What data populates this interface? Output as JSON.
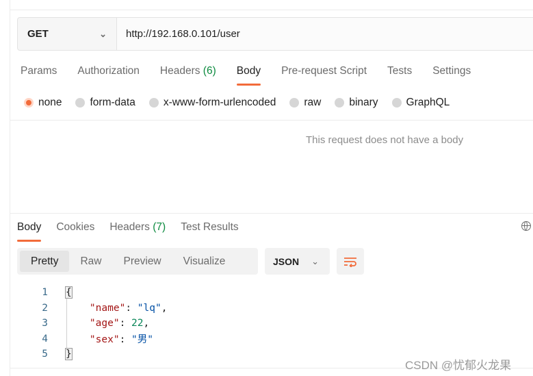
{
  "request": {
    "method": "GET",
    "url": "http://192.168.0.101/user"
  },
  "request_tabs": [
    {
      "label": "Params",
      "count": ""
    },
    {
      "label": "Authorization",
      "count": ""
    },
    {
      "label": "Headers",
      "count": "(6)"
    },
    {
      "label": "Body",
      "count": "",
      "active": true
    },
    {
      "label": "Pre-request Script",
      "count": ""
    },
    {
      "label": "Tests",
      "count": ""
    },
    {
      "label": "Settings",
      "count": ""
    }
  ],
  "body_types": [
    {
      "label": "none",
      "selected": true
    },
    {
      "label": "form-data"
    },
    {
      "label": "x-www-form-urlencoded"
    },
    {
      "label": "raw"
    },
    {
      "label": "binary"
    },
    {
      "label": "GraphQL"
    }
  ],
  "empty_body_message": "This request does not have a body",
  "response_tabs": [
    {
      "label": "Body",
      "count": "",
      "active": true
    },
    {
      "label": "Cookies",
      "count": ""
    },
    {
      "label": "Headers",
      "count": "(7)"
    },
    {
      "label": "Test Results",
      "count": ""
    }
  ],
  "view_modes": [
    "Pretty",
    "Raw",
    "Preview",
    "Visualize"
  ],
  "format": "JSON",
  "code_lines": [
    {
      "n": "1",
      "text": "{"
    },
    {
      "n": "2",
      "text": "    \"name\": \"lq\","
    },
    {
      "n": "3",
      "text": "    \"age\": 22,"
    },
    {
      "n": "4",
      "text": "    \"sex\": \"男\""
    },
    {
      "n": "5",
      "text": "}"
    }
  ],
  "watermark": "CSDN @忧郁火龙果",
  "colors": {
    "accent": "#f26b3a",
    "count": "#0b8a3e"
  },
  "icons": {
    "method_dropdown": "chevron-down-icon",
    "format_dropdown": "chevron-down-icon",
    "wrap": "wrap-lines-icon",
    "globe": "globe-icon"
  }
}
